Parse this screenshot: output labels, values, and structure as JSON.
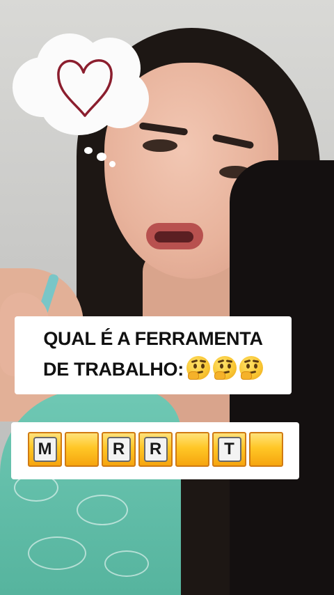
{
  "question": {
    "line1": "QUAL É A FERRAMENTA",
    "line2": "DE TRABALHO:",
    "emoji_icon": "thinking-face-icon",
    "emoji_count": 3
  },
  "answer": {
    "tiles": [
      "M",
      "",
      "R",
      "R",
      "",
      "T",
      ""
    ]
  },
  "sticker": {
    "icon": "heart-icon",
    "heart_color": "#8b1e2e"
  },
  "colors": {
    "tile_fill": "#ffc726",
    "tile_border": "#d07a12",
    "card_bg": "#ffffff"
  }
}
